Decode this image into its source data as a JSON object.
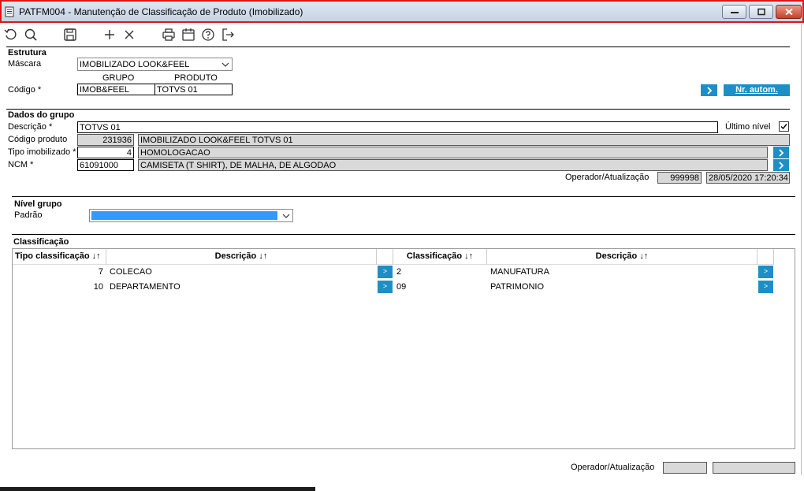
{
  "window": {
    "title": "PATFM004 - Manutenção de Classificação de Produto (Imobilizado)"
  },
  "toolbar": {
    "icons": [
      "undo-icon",
      "search-icon",
      "save-icon",
      "add-icon",
      "delete-icon",
      "print-icon",
      "calendar-icon",
      "help-icon",
      "exit-icon"
    ]
  },
  "estrutura": {
    "section_title": "Estrutura",
    "mascara_label": "Máscara",
    "mascara_value": "IMOBILIZADO LOOK&FEEL",
    "grupo_header": "GRUPO",
    "produto_header": "PRODUTO",
    "codigo_label": "Código *",
    "codigo_grupo": "IMOB&FEEL",
    "codigo_produto": "TOTVS 01",
    "go_button": ">",
    "nr_autom_button": "Nr. autom."
  },
  "dados_grupo": {
    "section_title": "Dados do grupo",
    "descricao_label": "Descrição *",
    "descricao_value": "TOTVS 01",
    "ultimo_nivel_label": "Último nível",
    "codigo_produto_label": "Código produto",
    "codigo_produto_value": "231936",
    "codigo_produto_desc": "IMOBILIZADO LOOK&FEEL TOTVS 01",
    "tipo_imob_label": "Tipo imobilizado *",
    "tipo_imob_value": "4",
    "tipo_imob_desc": "HOMOLOGACAO",
    "ncm_label": "NCM *",
    "ncm_value": "61091000",
    "ncm_desc": "CAMISETA (T SHIRT), DE MALHA, DE ALGODAO",
    "operador_label": "Operador/Atualização",
    "operador_value": "999998",
    "data_value": "28/05/2020 17:20:34"
  },
  "nivel_grupo": {
    "section_title": "Nível grupo",
    "padrao_label": "Padrão"
  },
  "classificacao": {
    "section_title": "Classificação",
    "headers": {
      "tipo": "Tipo classificação ↓↑",
      "descricao1": "Descrição ↓↑",
      "classificacao": "Classificação ↓↑",
      "descricao2": "Descrição ↓↑"
    },
    "rows": [
      {
        "tipo": "7",
        "descricao": "COLECAO",
        "btn": ">",
        "classificacao": "2",
        "descricao2": "MANUFATURA",
        "btn2": ">"
      },
      {
        "tipo": "10",
        "descricao": "DEPARTAMENTO",
        "btn": ">",
        "classificacao": "09",
        "descricao2": "PATRIMONIO",
        "btn2": ">"
      }
    ]
  },
  "footer": {
    "operador_label": "Operador/Atualização"
  },
  "colors": {
    "title_border": "#e0141b",
    "accent_button": "#1e8fc6",
    "selection": "#3399ff",
    "readonly": "#d9d9d9"
  }
}
